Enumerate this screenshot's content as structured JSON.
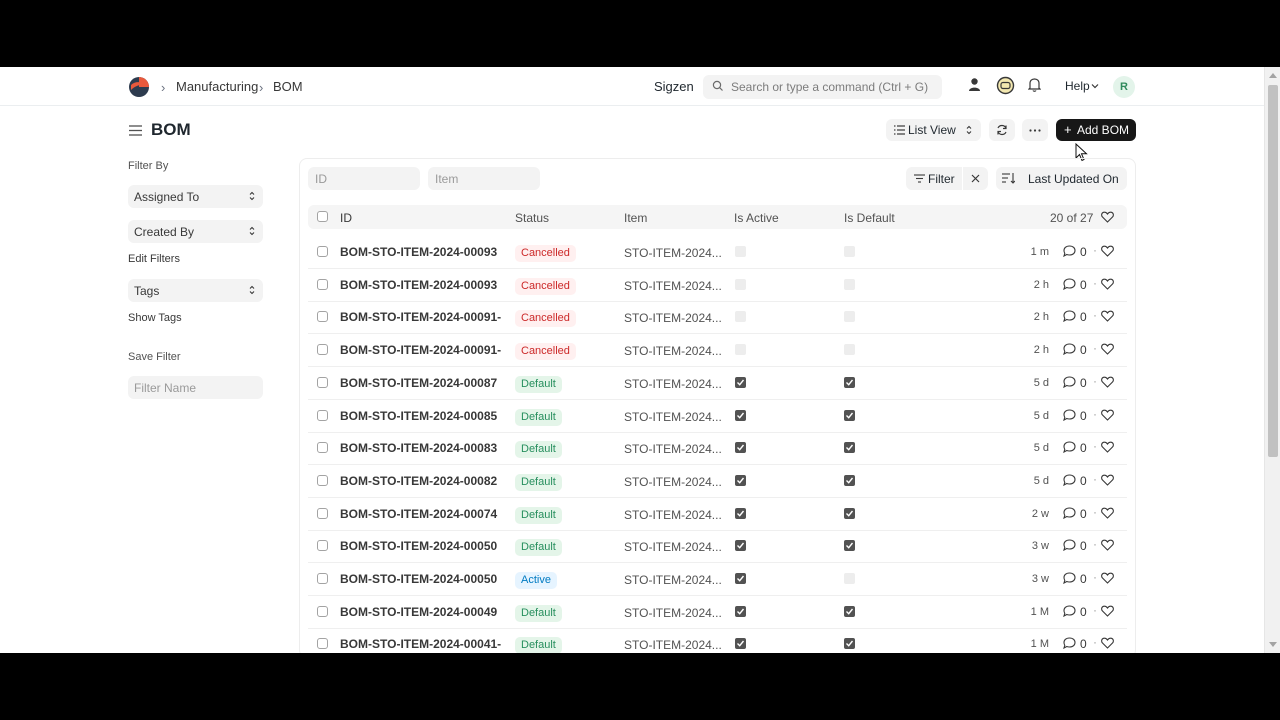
{
  "navbar": {
    "breadcrumbs": [
      "Manufacturing",
      "BOM"
    ],
    "company": "Sigzen",
    "search_placeholder": "Search or type a command (Ctrl + G)",
    "help_label": "Help",
    "avatar_initial": "R"
  },
  "page": {
    "title": "BOM",
    "list_view_label": "List View",
    "add_button_label": "Add BOM"
  },
  "sidebar": {
    "filter_by_label": "Filter By",
    "assigned_to_label": "Assigned To",
    "created_by_label": "Created By",
    "edit_filters_label": "Edit Filters",
    "tags_label": "Tags",
    "show_tags_label": "Show Tags",
    "save_filter_label": "Save Filter",
    "filter_name_placeholder": "Filter Name"
  },
  "list": {
    "id_placeholder": "ID",
    "item_placeholder": "Item",
    "filter_label": "Filter",
    "sort_label": "Last Updated On",
    "columns": [
      "ID",
      "Status",
      "Item",
      "Is Active",
      "Is Default"
    ],
    "count_label": "20 of 27",
    "rows": [
      {
        "id": "BOM-STO-ITEM-2024-00093",
        "status": "Cancelled",
        "item": "STO-ITEM-2024...",
        "active": false,
        "default": false,
        "time": "1 m",
        "comments": "0"
      },
      {
        "id": "BOM-STO-ITEM-2024-00093",
        "status": "Cancelled",
        "item": "STO-ITEM-2024...",
        "active": false,
        "default": false,
        "time": "2 h",
        "comments": "0"
      },
      {
        "id": "BOM-STO-ITEM-2024-00091-",
        "status": "Cancelled",
        "item": "STO-ITEM-2024...",
        "active": false,
        "default": false,
        "time": "2 h",
        "comments": "0"
      },
      {
        "id": "BOM-STO-ITEM-2024-00091-",
        "status": "Cancelled",
        "item": "STO-ITEM-2024...",
        "active": false,
        "default": false,
        "time": "2 h",
        "comments": "0"
      },
      {
        "id": "BOM-STO-ITEM-2024-00087",
        "status": "Default",
        "item": "STO-ITEM-2024...",
        "active": true,
        "default": true,
        "time": "5 d",
        "comments": "0"
      },
      {
        "id": "BOM-STO-ITEM-2024-00085",
        "status": "Default",
        "item": "STO-ITEM-2024...",
        "active": true,
        "default": true,
        "time": "5 d",
        "comments": "0"
      },
      {
        "id": "BOM-STO-ITEM-2024-00083",
        "status": "Default",
        "item": "STO-ITEM-2024...",
        "active": true,
        "default": true,
        "time": "5 d",
        "comments": "0"
      },
      {
        "id": "BOM-STO-ITEM-2024-00082",
        "status": "Default",
        "item": "STO-ITEM-2024...",
        "active": true,
        "default": true,
        "time": "5 d",
        "comments": "0"
      },
      {
        "id": "BOM-STO-ITEM-2024-00074",
        "status": "Default",
        "item": "STO-ITEM-2024...",
        "active": true,
        "default": true,
        "time": "2 w",
        "comments": "0"
      },
      {
        "id": "BOM-STO-ITEM-2024-00050",
        "status": "Default",
        "item": "STO-ITEM-2024...",
        "active": true,
        "default": true,
        "time": "3 w",
        "comments": "0"
      },
      {
        "id": "BOM-STO-ITEM-2024-00050",
        "status": "Active",
        "item": "STO-ITEM-2024...",
        "active": true,
        "default": false,
        "time": "3 w",
        "comments": "0"
      },
      {
        "id": "BOM-STO-ITEM-2024-00049",
        "status": "Default",
        "item": "STO-ITEM-2024...",
        "active": true,
        "default": true,
        "time": "1 M",
        "comments": "0"
      },
      {
        "id": "BOM-STO-ITEM-2024-00041-",
        "status": "Default",
        "item": "STO-ITEM-2024...",
        "active": true,
        "default": true,
        "time": "1 M",
        "comments": "0"
      }
    ]
  },
  "colors": {
    "cancelled": "#cc2929",
    "default": "#278f5e",
    "active": "#007bc2",
    "primary_button": "#171717"
  }
}
